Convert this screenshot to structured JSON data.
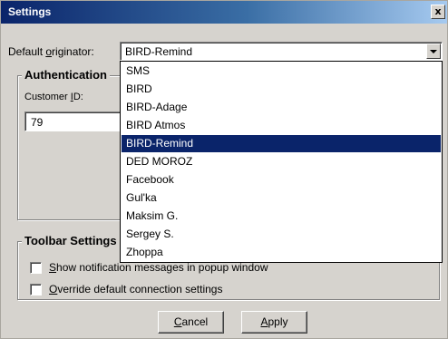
{
  "window": {
    "title": "Settings",
    "close_glyph": "x"
  },
  "originator": {
    "label_prefix": "Default ",
    "label_mnemonic": "o",
    "label_suffix": "riginator:",
    "selected": "BIRD-Remind",
    "options": [
      "SMS",
      "BIRD",
      "BIRD-Adage",
      "BIRD Atmos",
      "BIRD-Remind",
      "DED MOROZ",
      "Facebook",
      "Gul'ka",
      "Maksim G.",
      "Sergey S.",
      "Zhoppa"
    ],
    "highlighted_index": 4
  },
  "authentication": {
    "title": "Authentication",
    "customer_id_prefix": "Customer ",
    "customer_id_mnemonic": "I",
    "customer_id_suffix": "D:",
    "customer_id_value": "79"
  },
  "toolbar_settings": {
    "title": "Toolbar Settings",
    "show_notifications_mnemonic": "S",
    "show_notifications_rest": "how notification messages in popup window",
    "override_mnemonic": "O",
    "override_rest": "verride default connection settings"
  },
  "buttons": {
    "cancel_mnemonic": "C",
    "cancel_rest": "ancel",
    "apply_mnemonic": "A",
    "apply_rest": "pply"
  }
}
